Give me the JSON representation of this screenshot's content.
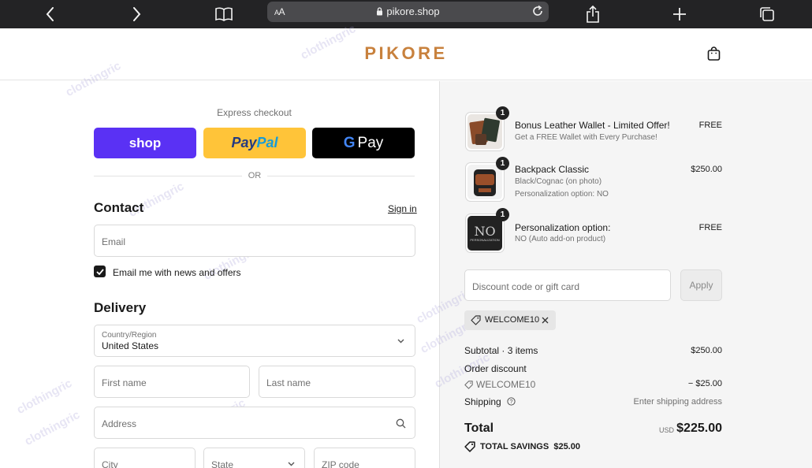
{
  "browser": {
    "url": "pikore.shop",
    "text_size_label": "AA"
  },
  "header": {
    "logo": "PIKORE"
  },
  "express": {
    "label": "Express checkout",
    "shop_label": "shop",
    "paypal_pay": "Pay",
    "paypal_pal": "Pal",
    "gpay_g": "G",
    "gpay_label": "Pay",
    "or_label": "OR"
  },
  "contact": {
    "heading": "Contact",
    "signin": "Sign in",
    "email_placeholder": "Email",
    "news_label": "Email me with news and offers",
    "news_checked": true
  },
  "delivery": {
    "heading": "Delivery",
    "country_label": "Country/Region",
    "country_value": "United States",
    "first_name": "First name",
    "last_name": "Last name",
    "address": "Address",
    "city": "City",
    "state": "State",
    "zip": "ZIP code"
  },
  "items": [
    {
      "qty": "1",
      "name": "Bonus Leather Wallet - Limited Offer!",
      "sub1": "Get a FREE Wallet with Every Purchase!",
      "sub2": "",
      "price": "FREE"
    },
    {
      "qty": "1",
      "name": "Backpack Classic",
      "sub1": "Black/Cognac (on photo)",
      "sub2": "Personalization option: NO",
      "price": "$250.00"
    },
    {
      "qty": "1",
      "name": "Personalization option:",
      "sub1": "NO (Auto add-on product)",
      "sub2": "",
      "price": "FREE",
      "thumb_text": "NO",
      "thumb_subtext": "PERSONALIZATION"
    }
  ],
  "discount": {
    "placeholder": "Discount code or gift card",
    "apply": "Apply",
    "applied_code": "WELCOME10"
  },
  "totals": {
    "subtotal_label": "Subtotal · 3 items",
    "subtotal_value": "$250.00",
    "order_discount_label": "Order discount",
    "discount_code": "WELCOME10",
    "discount_value": "− $25.00",
    "shipping_label": "Shipping",
    "shipping_value": "Enter shipping address",
    "total_label": "Total",
    "currency": "USD",
    "total_value": "$225.00",
    "savings_label": "TOTAL SAVINGS",
    "savings_value": "$25.00"
  },
  "watermark": "clothingric",
  "colors": {
    "brand": "#c8813d",
    "shop_pay": "#5a31f4",
    "paypal": "#ffc439",
    "gpay": "#000000"
  }
}
